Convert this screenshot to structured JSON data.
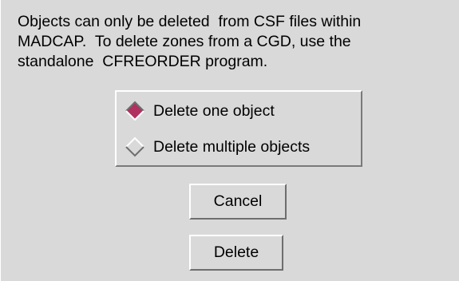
{
  "dialog": {
    "message_lines": [
      "Objects can only be deleted  from CSF files within",
      "MADCAP.  To delete zones from a CGD, use the",
      "standalone  CFREORDER program."
    ]
  },
  "radio_group": {
    "options": [
      {
        "label": "Delete one object",
        "selected": true
      },
      {
        "label": "Delete multiple objects",
        "selected": false
      }
    ]
  },
  "buttons": {
    "cancel_label": "Cancel",
    "delete_label": "Delete"
  },
  "colors": {
    "background": "#d9d9d9",
    "radio_selected": "#b03060",
    "text": "#000000"
  }
}
